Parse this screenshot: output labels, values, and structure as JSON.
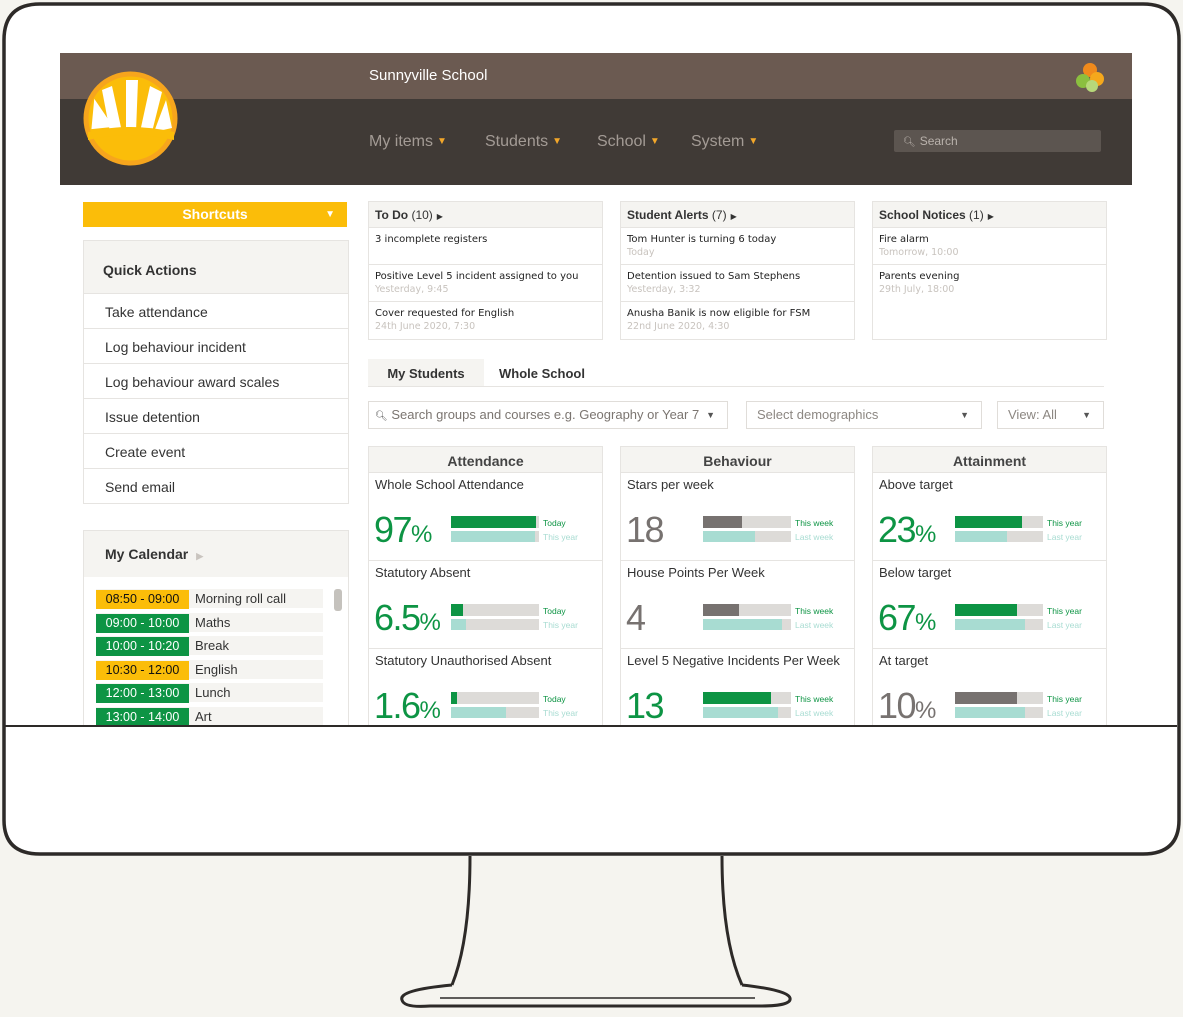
{
  "app": {
    "title": "Sunnyville School"
  },
  "nav": {
    "items": [
      "My items",
      "Students",
      "School",
      "System"
    ],
    "search_placeholder": "Search"
  },
  "shortcuts": {
    "label": "Shortcuts"
  },
  "quick_actions": {
    "title": "Quick Actions",
    "items": [
      "Take attendance",
      "Log behaviour incident",
      "Log behaviour award scales",
      "Issue detention",
      "Create event",
      "Send email"
    ]
  },
  "calendar": {
    "title": "My Calendar",
    "events": [
      {
        "time": "08:50 - 09:00",
        "label": "Morning roll call",
        "color": "#fbbd09"
      },
      {
        "time": "09:00 - 10:00",
        "label": "Maths",
        "color": "#0d9444"
      },
      {
        "time": "10:00 - 10:20",
        "label": "Break",
        "color": "#0d9444"
      },
      {
        "time": "10:30 - 12:00",
        "label": "English",
        "color": "#fbbd09"
      },
      {
        "time": "12:00 - 13:00",
        "label": "Lunch",
        "color": "#0d9444"
      },
      {
        "time": "13:00 - 14:00",
        "label": "Art",
        "color": "#0d9444"
      }
    ]
  },
  "panels": {
    "todo": {
      "title": "To Do",
      "count": "(10)",
      "items": [
        {
          "text": "3 incomplete registers",
          "sub": ""
        },
        {
          "text": "Positive Level 5 incident assigned to you",
          "sub": "Yesterday, 9:45"
        },
        {
          "text": "Cover requested for English",
          "sub": "24th June 2020, 7:30"
        }
      ]
    },
    "alerts": {
      "title": "Student Alerts",
      "count": "(7)",
      "items": [
        {
          "text": "Tom Hunter is turning 6 today",
          "sub": "Today"
        },
        {
          "text": "Detention issued to Sam Stephens",
          "sub": "Yesterday, 3:32"
        },
        {
          "text": "Anusha Banik is now eligible for FSM",
          "sub": "22nd June 2020, 4:30"
        }
      ]
    },
    "notices": {
      "title": "School Notices",
      "count": "(1)",
      "items": [
        {
          "text": "Fire alarm",
          "sub": "Tomorrow, 10:00"
        },
        {
          "text": "Parents evening",
          "sub": "29th July, 18:00"
        }
      ]
    }
  },
  "tabs": [
    "My Students",
    "Whole School"
  ],
  "filters": {
    "groups_placeholder": "Search groups and courses e.g. Geography or Year 7",
    "demographics_placeholder": "Select demographics",
    "view": "View: All"
  },
  "colors": {
    "green": "#0d9444",
    "grey": "#777270",
    "teal": "#a8dcd2",
    "track": "#dddbd8",
    "amber": "#fbbd09"
  },
  "metrics": {
    "attendance": {
      "title": "Attendance",
      "cards": [
        {
          "title": "Whole School Attendance",
          "value": "97",
          "unit": "%",
          "color": "green",
          "bar1": 0.97,
          "bar1_color": "green",
          "bar2": 0.95,
          "label1": "Today",
          "label2": "This year"
        },
        {
          "title": "Statutory Absent",
          "value": "6.5",
          "unit": "%",
          "color": "green",
          "bar1": 0.14,
          "bar1_color": "green",
          "bar2": 0.17,
          "label1": "Today",
          "label2": "This year"
        },
        {
          "title": "Statutory Unauthorised Absent",
          "value": "1.6",
          "unit": "%",
          "color": "green",
          "bar1": 0.07,
          "bar1_color": "green",
          "bar2": 0.62,
          "label1": "Today",
          "label2": "This year"
        }
      ]
    },
    "behaviour": {
      "title": "Behaviour",
      "cards": [
        {
          "title": "Stars per week",
          "value": "18",
          "unit": "",
          "color": "grey",
          "bar1": 0.44,
          "bar1_color": "grey",
          "bar2": 0.59,
          "label1": "This week",
          "label2": "Last week"
        },
        {
          "title": "House Points Per Week",
          "value": "4",
          "unit": "",
          "color": "grey",
          "bar1": 0.41,
          "bar1_color": "grey",
          "bar2": 0.9,
          "label1": "This week",
          "label2": "Last week"
        },
        {
          "title": "Level 5 Negative Incidents Per Week",
          "value": "13",
          "unit": "",
          "color": "green",
          "bar1": 0.77,
          "bar1_color": "green",
          "bar2": 0.85,
          "label1": "This week",
          "label2": "Last week"
        }
      ]
    },
    "attainment": {
      "title": "Attainment",
      "cards": [
        {
          "title": "Above target",
          "value": "23",
          "unit": "%",
          "color": "green",
          "bar1": 0.76,
          "bar1_color": "green",
          "bar2": 0.59,
          "label1": "This year",
          "label2": "Last year"
        },
        {
          "title": "Below target",
          "value": "67",
          "unit": "%",
          "color": "green",
          "bar1": 0.7,
          "bar1_color": "green",
          "bar2": 0.8,
          "label1": "This year",
          "label2": "Last year"
        },
        {
          "title": "At target",
          "value": "10",
          "unit": "%",
          "color": "grey",
          "bar1": 0.7,
          "bar1_color": "grey",
          "bar2": 0.8,
          "label1": "This year",
          "label2": "Last year"
        }
      ]
    }
  }
}
